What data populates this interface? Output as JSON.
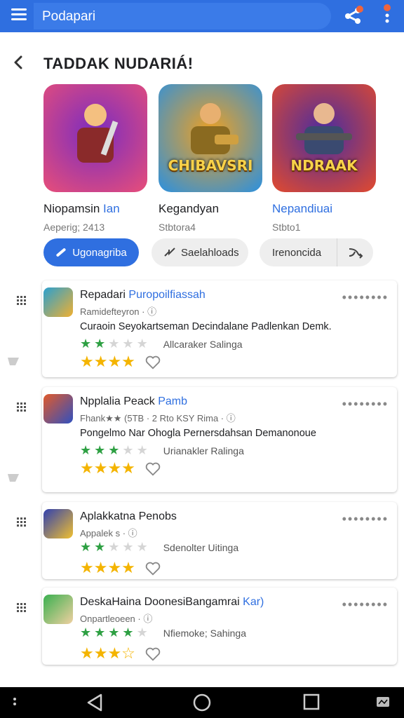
{
  "topbar": {
    "search_text": "Podapari"
  },
  "header": {
    "title": "TADDAK NUDARIÁ!"
  },
  "featured": [
    {
      "name": "Niopamsin",
      "name_hl": "Ian",
      "meta": "Aeperig; 2413",
      "caption": "",
      "colors": [
        "#e84e79",
        "#7a2cc0"
      ]
    },
    {
      "name": "Kegandyan",
      "name_hl": "",
      "meta": "Stbtora4",
      "caption": "CHIBAVSRI",
      "colors": [
        "#2a90e0",
        "#f0a020"
      ]
    },
    {
      "name": "",
      "name_hl": "Nepandiuai",
      "meta": "Stbto1",
      "caption": "NDRAAK",
      "colors": [
        "#e24a2e",
        "#4a2ca0"
      ]
    }
  ],
  "chips": {
    "primary": "Ugonagriba",
    "secondary": "Saelahloads",
    "tertiary": "Irenoncida"
  },
  "apps": [
    {
      "title": "Repadari",
      "title_hl": "Puropoilfiassah",
      "sub": "Ramidefteyron",
      "desc": "Curaoin Seyokartseman Decindalane Padlenkan Demk.",
      "green": 2,
      "rating_label": "Allcaraker Salinga",
      "gold": "★★★★",
      "icon": [
        "#2aa0d0",
        "#f0b030"
      ]
    },
    {
      "title": "Npplalia Peack",
      "title_hl": "Pamb",
      "sub": "Fhank★★ (5TB · 2 Rto KSY Rima",
      "desc": "Pongelmo Nar Ohogla Pernersdahsan Demanonoue",
      "green": 3,
      "rating_label": "Urianakler Ralinga",
      "gold": "★★★★",
      "icon": [
        "#e25a2a",
        "#3050c0"
      ]
    },
    {
      "title": "Aplakkatna Penobs",
      "title_hl": "",
      "sub": "Appalek s",
      "desc": "",
      "green": 2,
      "rating_label": "Sdenolter Uitinga",
      "gold": "★★★★",
      "icon": [
        "#3040b0",
        "#f0c030"
      ]
    },
    {
      "title": "DeskaHaina DoonesiBangamrai",
      "title_hl": "Kar)",
      "sub": "Onpartleoeen",
      "desc": "",
      "green": 4,
      "rating_label": "Nfiemoke; Sahinga",
      "gold": "★★★☆",
      "icon": [
        "#3ab050",
        "#f0d0a0"
      ]
    }
  ]
}
